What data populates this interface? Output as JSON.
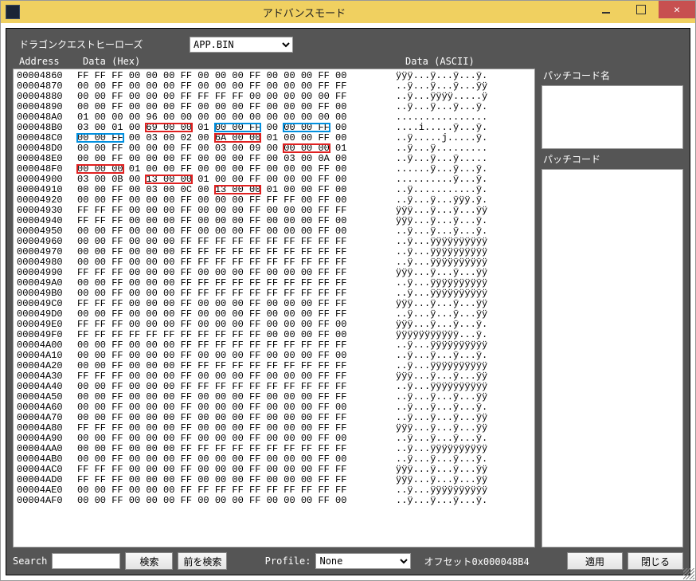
{
  "window": {
    "title": "アドバンスモード"
  },
  "top": {
    "game_name": "ドラゴンクエストヒーローズ",
    "file_options": [
      "APP.BIN"
    ],
    "file_selected": "APP.BIN"
  },
  "headers": {
    "address": "Address",
    "hex": "Data (Hex)",
    "ascii": "Data (ASCII)"
  },
  "side": {
    "name_label": "パッチコード名",
    "code_label": "パッチコード"
  },
  "bottom": {
    "search_label": "Search",
    "search_btn": "検索",
    "search_prev_btn": "前を検索",
    "profile_label": "Profile:",
    "profile_options": [
      "None"
    ],
    "profile_selected": "None",
    "offset_label": "オフセット0x000048B4",
    "apply_btn": "適用",
    "close_btn": "閉じる"
  },
  "rows": [
    {
      "a": "00004860",
      "h": "FF FF FF 00 00 00 FF 00 00 00 FF 00 00 00 FF 00",
      "s": "ÿÿÿ...ÿ...ÿ...ÿ."
    },
    {
      "a": "00004870",
      "h": "00 00 FF 00 00 00 FF 00 00 00 FF 00 00 00 FF FF",
      "s": "..ÿ...ÿ...ÿ...ÿÿ"
    },
    {
      "a": "00004880",
      "h": "00 00 FF 00 00 00 FF FF FF FF 00 00 00 00 00 FF",
      "s": "..ÿ...ÿÿÿÿ.....ÿ"
    },
    {
      "a": "00004890",
      "h": "00 00 FF 00 00 00 FF 00 00 00 FF 00 00 00 FF 00",
      "s": "..ÿ...ÿ...ÿ...ÿ."
    },
    {
      "a": "000048A0",
      "h": "01 00 00 00 96 00 00 00 00 00 00 00 00 00 00 00",
      "s": "................"
    },
    {
      "a": "000048B0",
      "h": "03 00 01 00 69 00 00 01 00 00 FF 00 00 00 FF 00",
      "s": "....i.....ÿ...ÿ.",
      "hl": [
        {
          "c": "red",
          "g0": 4,
          "g1": 6
        },
        {
          "c": "blue",
          "g0": 8,
          "g1": 10
        },
        {
          "c": "blue",
          "g0": 12,
          "g1": 14
        }
      ]
    },
    {
      "a": "000048C0",
      "h": "00 00 FF 00 03 00 02 00 6A 00 00 01 00 00 FF 00",
      "s": "..ÿ.....j.....ÿ.",
      "hl": [
        {
          "c": "blue",
          "g0": 0,
          "g1": 2
        },
        {
          "c": "red",
          "g0": 8,
          "g1": 10
        }
      ]
    },
    {
      "a": "000048D0",
      "h": "00 00 FF 00 00 00 FF 00 03 00 09 00 00 00 00 01",
      "s": "..ÿ...ÿ.........",
      "hl": [
        {
          "c": "red",
          "g0": 12,
          "g1": 14
        }
      ]
    },
    {
      "a": "000048E0",
      "h": "00 00 FF 00 00 00 FF 00 00 00 FF 00 03 00 0A 00",
      "s": "..ÿ...ÿ...ÿ....."
    },
    {
      "a": "000048F0",
      "h": "00 00 00 01 00 00 FF 00 00 00 FF 00 00 00 FF 00",
      "s": "......ÿ...ÿ...ÿ.",
      "hl": [
        {
          "c": "red",
          "g0": 0,
          "g1": 2
        }
      ]
    },
    {
      "a": "00004900",
      "h": "03 00 0B 00 13 00 00 01 00 00 FF 00 00 00 FF 00",
      "s": "..........ÿ...ÿ.",
      "hl": [
        {
          "c": "red",
          "g0": 4,
          "g1": 6
        }
      ]
    },
    {
      "a": "00004910",
      "h": "00 00 FF 00 03 00 0C 00 13 00 00 01 00 00 FF 00",
      "s": "..ÿ...........ÿ.",
      "hl": [
        {
          "c": "red",
          "g0": 8,
          "g1": 10
        }
      ]
    },
    {
      "a": "00004920",
      "h": "00 00 FF 00 00 00 FF 00 00 00 FF FF FF 00 FF 00",
      "s": "..ÿ...ÿ...ÿÿÿ.ÿ."
    },
    {
      "a": "00004930",
      "h": "FF FF FF 00 00 00 FF 00 00 00 FF 00 00 00 FF FF",
      "s": "ÿÿÿ...ÿ...ÿ...ÿÿ"
    },
    {
      "a": "00004940",
      "h": "FF FF FF 00 00 00 FF 00 00 00 FF 00 00 00 FF 00",
      "s": "ÿÿÿ...ÿ...ÿ...ÿ."
    },
    {
      "a": "00004950",
      "h": "00 00 FF 00 00 00 FF 00 00 00 FF 00 00 00 FF 00",
      "s": "..ÿ...ÿ...ÿ...ÿ."
    },
    {
      "a": "00004960",
      "h": "00 00 FF 00 00 00 FF FF FF FF FF FF FF FF FF FF",
      "s": "..ÿ...ÿÿÿÿÿÿÿÿÿÿ"
    },
    {
      "a": "00004970",
      "h": "00 00 FF 00 00 00 FF FF FF FF FF FF FF FF FF FF",
      "s": "..ÿ...ÿÿÿÿÿÿÿÿÿÿ"
    },
    {
      "a": "00004980",
      "h": "00 00 FF 00 00 00 FF FF FF FF FF FF FF FF FF FF",
      "s": "..ÿ...ÿÿÿÿÿÿÿÿÿÿ"
    },
    {
      "a": "00004990",
      "h": "FF FF FF 00 00 00 FF 00 00 00 FF 00 00 00 FF FF",
      "s": "ÿÿÿ...ÿ...ÿ...ÿÿ"
    },
    {
      "a": "000049A0",
      "h": "00 00 FF 00 00 00 FF FF FF FF FF FF FF FF FF FF",
      "s": "..ÿ...ÿÿÿÿÿÿÿÿÿÿ"
    },
    {
      "a": "000049B0",
      "h": "00 00 FF 00 00 00 FF FF FF FF FF FF FF FF FF FF",
      "s": "..ÿ...ÿÿÿÿÿÿÿÿÿÿ"
    },
    {
      "a": "000049C0",
      "h": "FF FF FF 00 00 00 FF 00 00 00 FF 00 00 00 FF FF",
      "s": "ÿÿÿ...ÿ...ÿ...ÿÿ"
    },
    {
      "a": "000049D0",
      "h": "00 00 FF 00 00 00 FF 00 00 00 FF 00 00 00 FF FF",
      "s": "..ÿ...ÿ...ÿ...ÿÿ"
    },
    {
      "a": "000049E0",
      "h": "FF FF FF 00 00 00 FF 00 00 00 FF 00 00 00 FF 00",
      "s": "ÿÿÿ...ÿ...ÿ...ÿ."
    },
    {
      "a": "000049F0",
      "h": "FF FF FF FF FF FF FF FF FF FF FF 00 00 00 FF 00",
      "s": "ÿÿÿÿÿÿÿÿÿÿÿ...ÿ."
    },
    {
      "a": "00004A00",
      "h": "00 00 FF 00 00 00 FF FF FF FF FF FF FF FF FF FF",
      "s": "..ÿ...ÿÿÿÿÿÿÿÿÿÿ"
    },
    {
      "a": "00004A10",
      "h": "00 00 FF 00 00 00 FF 00 00 00 FF 00 00 00 FF 00",
      "s": "..ÿ...ÿ...ÿ...ÿ."
    },
    {
      "a": "00004A20",
      "h": "00 00 FF 00 00 00 FF FF FF FF FF FF FF FF FF FF",
      "s": "..ÿ...ÿÿÿÿÿÿÿÿÿÿ"
    },
    {
      "a": "00004A30",
      "h": "FF FF FF 00 00 00 FF 00 00 00 FF 00 00 00 FF FF",
      "s": "ÿÿÿ...ÿ...ÿ...ÿÿ"
    },
    {
      "a": "00004A40",
      "h": "00 00 FF 00 00 00 FF FF FF FF FF FF FF FF FF FF",
      "s": "..ÿ...ÿÿÿÿÿÿÿÿÿÿ"
    },
    {
      "a": "00004A50",
      "h": "00 00 FF 00 00 00 FF 00 00 00 FF 00 00 00 FF FF",
      "s": "..ÿ...ÿ...ÿ...ÿÿ"
    },
    {
      "a": "00004A60",
      "h": "00 00 FF 00 00 00 FF 00 00 00 FF 00 00 00 FF 00",
      "s": "..ÿ...ÿ...ÿ...ÿ."
    },
    {
      "a": "00004A70",
      "h": "00 00 FF 00 00 00 FF 00 00 00 FF 00 00 00 FF FF",
      "s": "..ÿ...ÿ...ÿ...ÿÿ"
    },
    {
      "a": "00004A80",
      "h": "FF FF FF 00 00 00 FF 00 00 00 FF 00 00 00 FF FF",
      "s": "ÿÿÿ...ÿ...ÿ...ÿÿ"
    },
    {
      "a": "00004A90",
      "h": "00 00 FF 00 00 00 FF 00 00 00 FF 00 00 00 FF 00",
      "s": "..ÿ...ÿ...ÿ...ÿ."
    },
    {
      "a": "00004AA0",
      "h": "00 00 FF 00 00 00 FF FF FF FF FF FF FF FF FF FF",
      "s": "..ÿ...ÿÿÿÿÿÿÿÿÿÿ"
    },
    {
      "a": "00004AB0",
      "h": "00 00 FF 00 00 00 FF 00 00 00 FF 00 00 00 FF 00",
      "s": "..ÿ...ÿ...ÿ...ÿ."
    },
    {
      "a": "00004AC0",
      "h": "FF FF FF 00 00 00 FF 00 00 00 FF 00 00 00 FF FF",
      "s": "ÿÿÿ...ÿ...ÿ...ÿÿ"
    },
    {
      "a": "00004AD0",
      "h": "FF FF FF 00 00 00 FF 00 00 00 FF 00 00 00 FF FF",
      "s": "ÿÿÿ...ÿ...ÿ...ÿÿ"
    },
    {
      "a": "00004AE0",
      "h": "00 00 FF 00 00 00 FF FF FF FF FF FF FF FF FF FF",
      "s": "..ÿ...ÿÿÿÿÿÿÿÿÿÿ"
    },
    {
      "a": "00004AF0",
      "h": "00 00 FF 00 00 00 FF 00 00 00 FF 00 00 00 FF 00",
      "s": "..ÿ...ÿ...ÿ...ÿ."
    }
  ]
}
